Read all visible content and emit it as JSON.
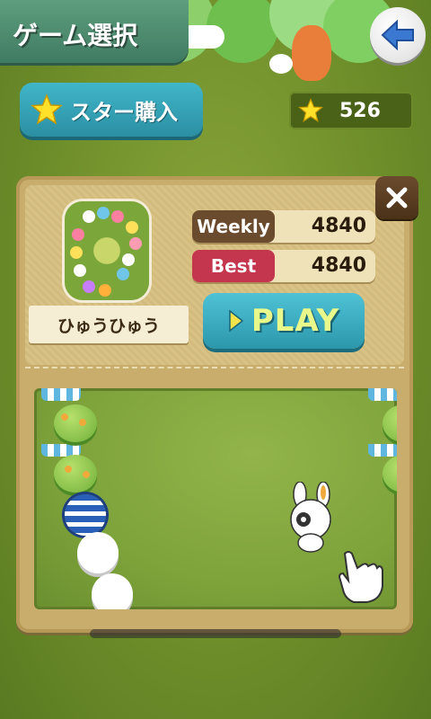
{
  "header": {
    "title": "ゲーム選択",
    "back_icon": "back-arrow-icon"
  },
  "toolbar": {
    "star_buy_label": "スター購入",
    "star_icon": "star-icon",
    "star_count": "526"
  },
  "stage_panel": {
    "stage_name": "ひゅうひゅう",
    "weekly_label": "Weekly",
    "weekly_score": "4840",
    "best_label": "Best",
    "best_score": "4840",
    "play_label": "PLAY",
    "close_icon": "close-icon"
  },
  "colors": {
    "weekly_tag": "#6b4b2d",
    "best_tag": "#c4364e",
    "play_button": "#2c97ab",
    "play_text": "#e9f88a",
    "star_button": "#2b8fa3"
  }
}
